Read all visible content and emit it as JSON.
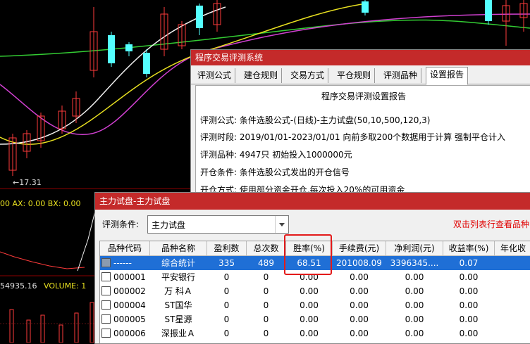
{
  "chart_labels": {
    "price_low": "←17.31",
    "indicator": "00  AX: 0.00  BX: 0.00",
    "volume_value": "54935.16",
    "volume_label": "VOLUME: 1"
  },
  "colors": {
    "up": "#ff3b3b",
    "down": "#54ffff",
    "title_bar": "#c42a2a",
    "selected_row": "#1f6fd6",
    "highlight": "#e31a1a"
  },
  "dialog_back": {
    "title": "程序交易评测系统",
    "tabs": [
      "评测公式",
      "建仓规则",
      "交易方式",
      "平仓规则",
      "评测品种",
      "设置报告"
    ],
    "active_tab": "设置报告",
    "report_title": "程序交易评测设置报告",
    "lines": [
      "评测公式: 条件选股公式-(日线)-主力试盘(50,10,500,120,3)",
      "评测时段: 2019/01/01-2023/01/01 向前多取200个数据用于计算 强制平仓计入",
      "评测品种: 4947只 初始投入1000000元",
      "开仓条件: 条件选股公式发出的开仓信号",
      "开仓方式: 使用部分资金开仓,每次投入20%的可用资金"
    ]
  },
  "dialog_front": {
    "title": "主力试盘-主力试盘",
    "condition_label": "评测条件:",
    "condition_value": "主力试盘",
    "hint": "双击列表行查看品种",
    "columns": [
      "品种代码",
      "品种名称",
      "盈利数",
      "总次数",
      "胜率(%)",
      "手续费(元)",
      "净利润(元)",
      "收益率(%)",
      "年化收"
    ],
    "rows": [
      [
        "------",
        "综合统计",
        "335",
        "489",
        "68.51",
        "201008.09",
        "3396345....",
        "0.07"
      ],
      [
        "000001",
        "平安银行",
        "0",
        "0",
        "0.00",
        "0.00",
        "0.00",
        "0.00"
      ],
      [
        "000002",
        "万 科Ａ",
        "0",
        "0",
        "0.00",
        "0.00",
        "0.00",
        "0.00"
      ],
      [
        "000004",
        "ST国华",
        "0",
        "0",
        "0.00",
        "0.00",
        "0.00",
        "0.00"
      ],
      [
        "000005",
        "ST星源",
        "0",
        "0",
        "0.00",
        "0.00",
        "0.00",
        "0.00"
      ],
      [
        "000006",
        "深振业Ａ",
        "0",
        "0",
        "0.00",
        "0.00",
        "0.00",
        "0.00"
      ]
    ]
  }
}
